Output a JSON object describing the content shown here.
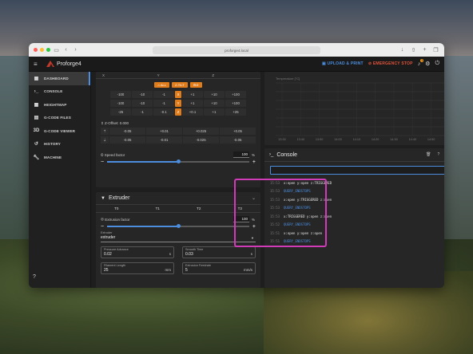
{
  "browser": {
    "url": "proforge4.local"
  },
  "app": {
    "title": "Proforge4",
    "upload_label": "UPLOAD & PRINT",
    "estop_label": "EMERGENCY STOP",
    "notification_count": "1",
    "accent": "#4c8dde",
    "orange": "#e07c1a"
  },
  "sidebar": {
    "items": [
      {
        "label": "DASHBOARD",
        "icon": "dashboard-icon"
      },
      {
        "label": "CONSOLE",
        "icon": "console-icon"
      },
      {
        "label": "HEIGHTMAP",
        "icon": "grid-icon"
      },
      {
        "label": "G-CODE FILES",
        "icon": "file-icon"
      },
      {
        "label": "G-CODE VIEWER",
        "icon": "3d-icon"
      },
      {
        "label": "HISTORY",
        "icon": "history-icon"
      },
      {
        "label": "MACHINE",
        "icon": "wrench-icon"
      }
    ]
  },
  "toolhead": {
    "axes": [
      "X",
      "Y",
      "Z"
    ],
    "home_all": "ALL",
    "home_tilt": "Z-TILT",
    "jog_x": [
      "-100",
      "-10",
      "-1",
      "X",
      "+1",
      "+10",
      "+100"
    ],
    "jog_y": [
      "-100",
      "-10",
      "-1",
      "Y",
      "+1",
      "+10",
      "+100"
    ],
    "jog_z": [
      "-25",
      "-1",
      "-0.1",
      "Z",
      "+0.1",
      "+1",
      "+25"
    ],
    "zoffset_label": "Z-Offset: 0.000",
    "zoffset_up": [
      "-0.05",
      "+0.01",
      "+0.025",
      "+0.05"
    ],
    "zoffset_down": [
      "-0.05",
      "-0.01",
      "-0.025",
      "-0.05"
    ],
    "speed_label": "Speed factor",
    "speed_value": "100",
    "speed_unit": "%",
    "speed_level": 0.5
  },
  "extruder": {
    "title": "Extruder",
    "tools": [
      "T0",
      "T1",
      "T2",
      "T3"
    ],
    "extrusion_label": "Extrusion factor",
    "extrusion_value": "100",
    "extrusion_unit": "%",
    "select_label": "Extruder",
    "select_value": "extruder",
    "pressure_advance_label": "Pressure Advance",
    "pressure_advance_value": "0.02",
    "pressure_advance_unit": "s",
    "smooth_time_label": "Smooth Time",
    "smooth_time_value": "0.03",
    "smooth_time_unit": "s",
    "filament_length_label": "Filament Length",
    "filament_length_value": "25",
    "filament_length_unit": "mm",
    "extrusion_feedrate_label": "Extrusion Feedrate",
    "extrusion_feedrate_value": "5",
    "extrusion_feedrate_unit": "mm/s"
  },
  "temperature_chart": {
    "ylabel": "Temperature [°C]",
    "x_ticks": [
      "13:30",
      "13:40",
      "13:50",
      "14:00",
      "14:10",
      "14:20",
      "14:30",
      "14:40",
      "14:50",
      "15:00"
    ]
  },
  "console": {
    "title": "Console",
    "lines": [
      {
        "time": "15:53",
        "msg": "x:open y:open z:TRIGGERED",
        "cmd": false
      },
      {
        "time": "15:53",
        "msg": "QUERY_ENDSTOPS",
        "cmd": true
      },
      {
        "time": "15:53",
        "msg": "x:open y:TRIGGERED z:open",
        "cmd": false
      },
      {
        "time": "15:53",
        "msg": "QUERY_ENDSTOPS",
        "cmd": true
      },
      {
        "time": "15:53",
        "msg": "x:TRIGGERED y:open z:open",
        "cmd": false
      },
      {
        "time": "15:52",
        "msg": "QUERY_ENDSTOPS",
        "cmd": true
      },
      {
        "time": "15:51",
        "msg": "x:open y:open z:open",
        "cmd": false
      },
      {
        "time": "15:51",
        "msg": "QUERY_ENDSTOPS",
        "cmd": true
      }
    ]
  }
}
